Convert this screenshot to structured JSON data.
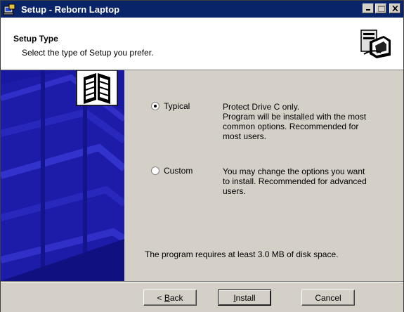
{
  "window": {
    "title": "Setup - Reborn Laptop"
  },
  "header": {
    "title": "Setup Type",
    "subtitle": "Select the type of Setup you prefer."
  },
  "options": [
    {
      "label": "Typical",
      "checked": true,
      "description_lines": [
        "Protect Drive C only.",
        "Program will be installed with the most",
        "common options. Recommended for",
        "most users."
      ]
    },
    {
      "label": "Custom",
      "checked": false,
      "description_lines": [
        "You may change the options you want",
        "to install. Recommended for advanced",
        "users."
      ]
    }
  ],
  "disk_space": "The program requires at least 3.0 MB of disk space.",
  "buttons": {
    "back_prefix": "< ",
    "back_mnemonic": "B",
    "back_rest": "ack",
    "install_mnemonic": "I",
    "install_rest": "nstall",
    "cancel": "Cancel"
  },
  "colors": {
    "titlebar": "#0a246a",
    "side_blue": "#1a1aa8",
    "face": "#d4d0c8"
  }
}
